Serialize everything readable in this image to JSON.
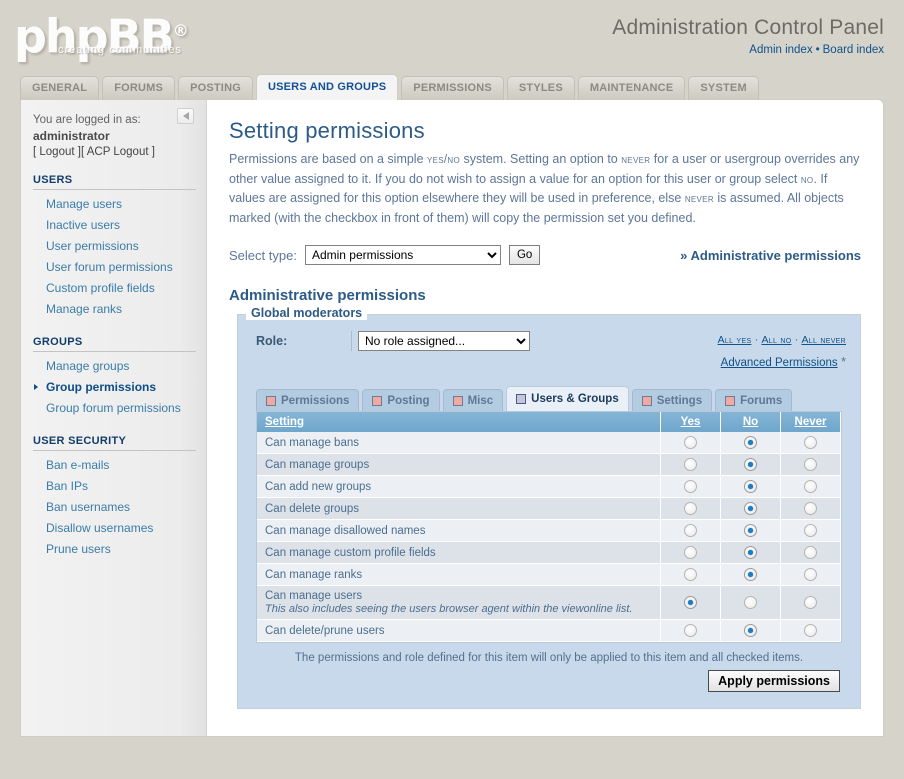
{
  "header": {
    "logo_text": "phpBB",
    "logo_reg": "®",
    "logo_sub": "creating communities",
    "title": "Administration Control Panel",
    "admin_index": "Admin index",
    "separator": "•",
    "board_index": "Board index"
  },
  "main_tabs": [
    {
      "label": "GENERAL",
      "active": false
    },
    {
      "label": "FORUMS",
      "active": false
    },
    {
      "label": "POSTING",
      "active": false
    },
    {
      "label": "USERS AND GROUPS",
      "active": true
    },
    {
      "label": "PERMISSIONS",
      "active": false
    },
    {
      "label": "STYLES",
      "active": false
    },
    {
      "label": "MAINTENANCE",
      "active": false
    },
    {
      "label": "SYSTEM",
      "active": false
    }
  ],
  "sidebar": {
    "logged_in_as": "You are logged in as:",
    "username": "administrator",
    "logout": "[ Logout ]",
    "acp_logout": "[ ACP Logout ]",
    "collapse_icon": "triangle-left-icon",
    "groups": [
      {
        "heading": "USERS",
        "items": [
          {
            "label": "Manage users",
            "selected": false
          },
          {
            "label": "Inactive users",
            "selected": false
          },
          {
            "label": "User permissions",
            "selected": false
          },
          {
            "label": "User forum permissions",
            "selected": false
          },
          {
            "label": "Custom profile fields",
            "selected": false
          },
          {
            "label": "Manage ranks",
            "selected": false
          }
        ]
      },
      {
        "heading": "GROUPS",
        "items": [
          {
            "label": "Manage groups",
            "selected": false
          },
          {
            "label": "Group permissions",
            "selected": true
          },
          {
            "label": "Group forum permissions",
            "selected": false
          }
        ]
      },
      {
        "heading": "USER SECURITY",
        "items": [
          {
            "label": "Ban e-mails",
            "selected": false
          },
          {
            "label": "Ban IPs",
            "selected": false
          },
          {
            "label": "Ban usernames",
            "selected": false
          },
          {
            "label": "Disallow usernames",
            "selected": false
          },
          {
            "label": "Prune users",
            "selected": false
          }
        ]
      }
    ]
  },
  "content": {
    "page_title": "Setting permissions",
    "intro_1": "Permissions are based on a simple ",
    "intro_sc1": "yes/no",
    "intro_2": " system. Setting an option to ",
    "intro_sc2": "never",
    "intro_3": " for a user or usergroup overrides any other value assigned to it. If you do not wish to assign a value for an option for this user or group select ",
    "intro_sc3": "no",
    "intro_4": ". If values are assigned for this option elsewhere they will be used in preference, else ",
    "intro_sc4": "never",
    "intro_5": " is assumed. All objects marked (with the checkbox in front of them) will copy the permission set you defined.",
    "select_type_label": "Select type:",
    "type_select_value": "Admin permissions",
    "type_select_options": [
      "Admin permissions"
    ],
    "go_label": "Go",
    "breadcrumb": "» Administrative permissions",
    "section_title": "Administrative permissions",
    "fieldset_legend": "Global moderators",
    "role_label": "Role:",
    "role_select_value": "No role assigned...",
    "role_select_options": [
      "No role assigned..."
    ],
    "all_yes": "All yes",
    "all_no": "All no",
    "all_never": "All never",
    "all_separator": "·",
    "advanced_permissions": "Advanced Permissions",
    "advanced_star": "*",
    "perm_tabs": [
      {
        "label": "Permissions",
        "active": false
      },
      {
        "label": "Posting",
        "active": false
      },
      {
        "label": "Misc",
        "active": false
      },
      {
        "label": "Users & Groups",
        "active": true
      },
      {
        "label": "Settings",
        "active": false
      },
      {
        "label": "Forums",
        "active": false
      }
    ],
    "table": {
      "columns": [
        "Setting",
        "Yes",
        "No",
        "Never"
      ],
      "rows": [
        {
          "setting": "Can manage bans",
          "note": "",
          "value": "No"
        },
        {
          "setting": "Can manage groups",
          "note": "",
          "value": "No"
        },
        {
          "setting": "Can add new groups",
          "note": "",
          "value": "No"
        },
        {
          "setting": "Can delete groups",
          "note": "",
          "value": "No"
        },
        {
          "setting": "Can manage disallowed names",
          "note": "",
          "value": "No"
        },
        {
          "setting": "Can manage custom profile fields",
          "note": "",
          "value": "No"
        },
        {
          "setting": "Can manage ranks",
          "note": "",
          "value": "No"
        },
        {
          "setting": "Can manage users",
          "note": "This also includes seeing the users browser agent within the viewonline list.",
          "value": "Yes"
        },
        {
          "setting": "Can delete/prune users",
          "note": "",
          "value": "No"
        }
      ]
    },
    "footnote": "The permissions and role defined for this item will only be applied to this item and all checked items.",
    "apply_label": "Apply permissions"
  },
  "colors": {
    "page_bg": "#d6d3ca",
    "panel_bg": "#ffffff",
    "accent_blue": "#2d5b87",
    "link_blue": "#105289",
    "fieldset_bg": "#c7d9ea",
    "table_header": "#6fa6cc",
    "row_odd": "#eceff3",
    "row_even": "#dde2e8",
    "tab_checkbox_off": "#f0a9a4",
    "tab_checkbox_on": "#c3c6e2",
    "radio_dot": "#1b7ec2"
  }
}
